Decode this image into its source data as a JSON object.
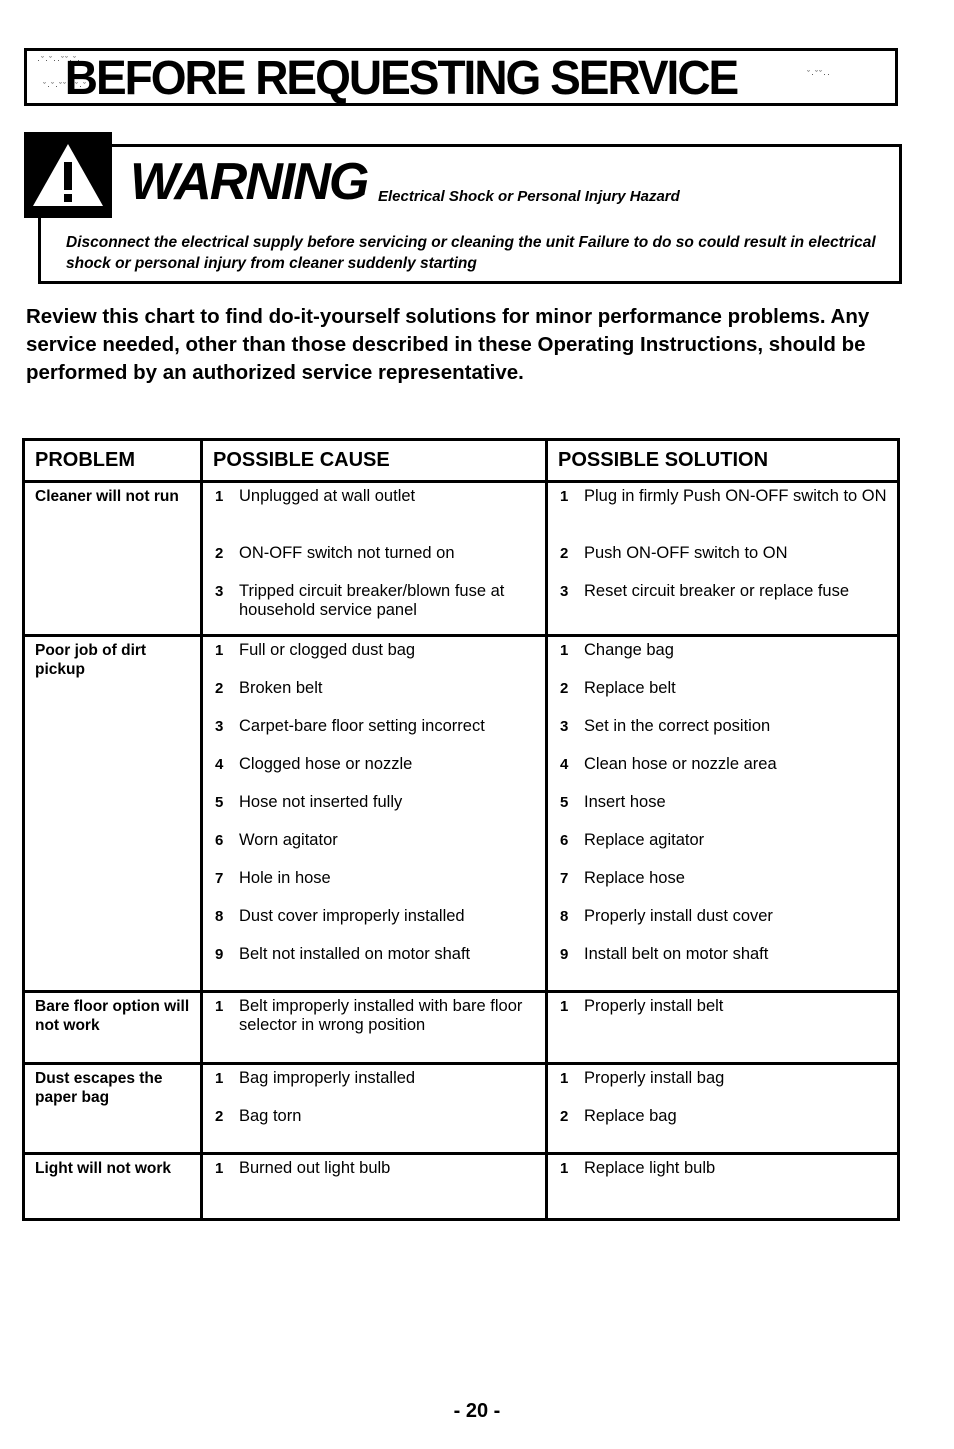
{
  "header": {
    "title": "BEFORE REQUESTING SERVICE"
  },
  "warning": {
    "icon": "warning-triangle-icon",
    "label": "WARNING",
    "subtitle": "Electrical Shock or Personal Injury Hazard",
    "text": "Disconnect the electrical supply before servicing or cleaning the unit  Failure to do so could result in electrical shock or personal injury from cleaner suddenly starting"
  },
  "intro": "Review this chart to find do-it-yourself solutions for minor performance problems. Any service needed, other than those described in these Operating Instructions, should be performed by an authorized service representative.",
  "table": {
    "headers": [
      "PROBLEM",
      "POSSIBLE CAUSE",
      "POSSIBLE SOLUTION"
    ],
    "rows": [
      {
        "problem": "Cleaner will not run",
        "causes": [
          {
            "num": "1",
            "text": "Unplugged at wall outlet"
          },
          {
            "num": "2",
            "text": "ON-OFF switch not turned on"
          },
          {
            "num": "3",
            "text": "Tripped circuit breaker/blown fuse at household service panel"
          }
        ],
        "solutions": [
          {
            "num": "1",
            "text": "Plug in firmly  Push ON-OFF switch to ON"
          },
          {
            "num": "2",
            "text": "Push ON-OFF switch to ON"
          },
          {
            "num": "3",
            "text": "Reset circuit breaker or replace fuse"
          }
        ]
      },
      {
        "problem": "Poor job of dirt pickup",
        "causes": [
          {
            "num": "1",
            "text": "Full or clogged dust bag"
          },
          {
            "num": "2",
            "text": "Broken belt"
          },
          {
            "num": "3",
            "text": "Carpet-bare floor setting incorrect"
          },
          {
            "num": "4",
            "text": "Clogged hose or nozzle"
          },
          {
            "num": "5",
            "text": "Hose not inserted fully"
          },
          {
            "num": "6",
            "text": "Worn agitator"
          },
          {
            "num": "7",
            "text": "Hole in hose"
          },
          {
            "num": "8",
            "text": "Dust cover improperly installed"
          },
          {
            "num": "9",
            "text": "Belt not installed on motor shaft"
          }
        ],
        "solutions": [
          {
            "num": "1",
            "text": "Change bag"
          },
          {
            "num": "2",
            "text": "Replace belt"
          },
          {
            "num": "3",
            "text": "Set in the correct position"
          },
          {
            "num": "4",
            "text": "Clean hose or nozzle area"
          },
          {
            "num": "5",
            "text": "Insert hose"
          },
          {
            "num": "6",
            "text": "Replace agitator"
          },
          {
            "num": "7",
            "text": "Replace hose"
          },
          {
            "num": "8",
            "text": "Properly install dust cover"
          },
          {
            "num": "9",
            "text": "Install belt on motor shaft"
          }
        ]
      },
      {
        "problem": "Bare floor option will not work",
        "causes": [
          {
            "num": "1",
            "text": "Belt improperly installed with bare floor selector in wrong position"
          }
        ],
        "solutions": [
          {
            "num": "1",
            "text": "Properly install belt"
          }
        ]
      },
      {
        "problem": "Dust escapes the paper bag",
        "causes": [
          {
            "num": "1",
            "text": "Bag improperly installed"
          },
          {
            "num": "2",
            "text": "Bag torn"
          }
        ],
        "solutions": [
          {
            "num": "1",
            "text": "Properly install bag"
          },
          {
            "num": "2",
            "text": "Replace bag"
          }
        ]
      },
      {
        "problem": "Light will not work",
        "causes": [
          {
            "num": "1",
            "text": "Burned out light bulb"
          }
        ],
        "solutions": [
          {
            "num": "1",
            "text": "Replace light bulb"
          }
        ]
      }
    ]
  },
  "footer": {
    "page_number": "- 20 -"
  }
}
